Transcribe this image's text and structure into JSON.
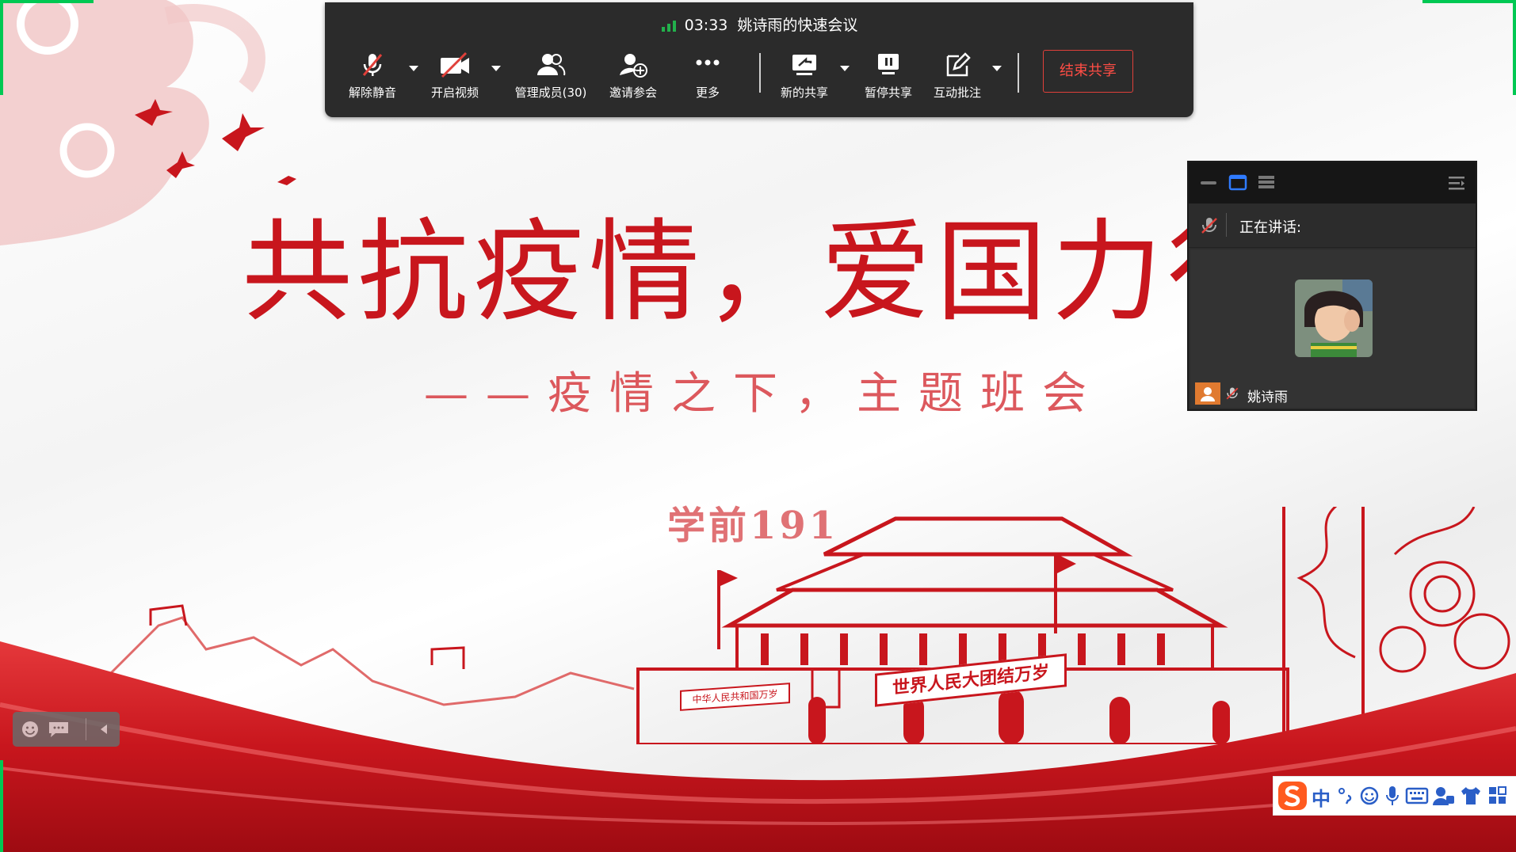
{
  "meeting": {
    "time": "03:33",
    "title": "姚诗雨的快速会议",
    "signal_color": "#22b14c"
  },
  "toolbar": {
    "buttons": [
      {
        "id": "unmute",
        "label": "解除静音",
        "icon": "microphone-muted-icon"
      },
      {
        "id": "video",
        "label": "开启视频",
        "icon": "camera-off-icon"
      },
      {
        "id": "members",
        "label": "管理成员(30)",
        "icon": "members-icon"
      },
      {
        "id": "invite",
        "label": "邀请参会",
        "icon": "invite-user-icon"
      },
      {
        "id": "more",
        "label": "更多",
        "icon": "more-dots-icon"
      },
      {
        "id": "new_share",
        "label": "新的共享",
        "icon": "share-screen-icon"
      },
      {
        "id": "pause_share",
        "label": "暂停共享",
        "icon": "pause-icon"
      },
      {
        "id": "annotate",
        "label": "互动批注",
        "icon": "edit-icon"
      }
    ],
    "end_share": "结束共享",
    "end_share_color": "#e0403a"
  },
  "speaker_panel": {
    "speaking_label": "正在讲话:",
    "user_name": "姚诗雨"
  },
  "slide": {
    "title": "共抗疫情，爱国力行",
    "subtitle": "——疫情之下，主题班会",
    "class_name": "学前191",
    "banner_left": "中华人民共和国万岁",
    "banner_right": "世界人民大团结万岁",
    "accent_color": "#c8161d"
  },
  "ime": {
    "language": "中"
  }
}
